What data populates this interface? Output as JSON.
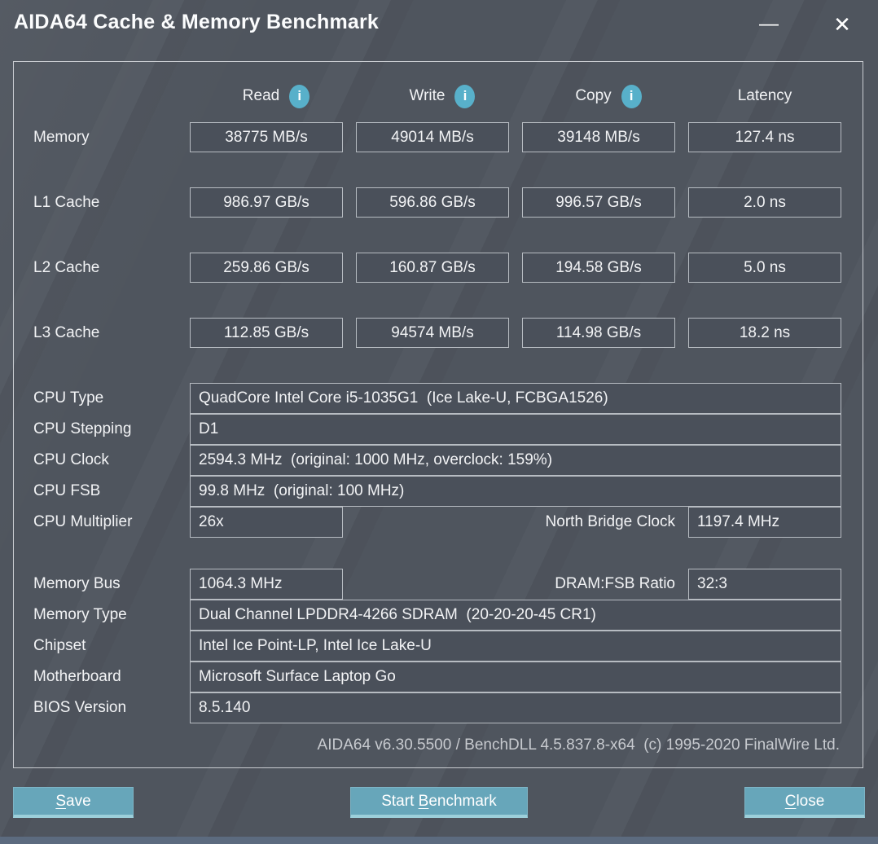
{
  "window": {
    "title": "AIDA64 Cache & Memory Benchmark",
    "minimize_glyph": "—",
    "close_glyph": "✕"
  },
  "colors": {
    "background": "#4f555e",
    "field_fill": "#4a505a",
    "field_border": "#b7bcc2",
    "info_icon_teal": "#58b0ca",
    "button_teal": "#67a6ba",
    "button_bottom_highlight": "#9ccfda",
    "bottom_strip": "#5c6b7f"
  },
  "info_glyph": "i",
  "benchmark": {
    "columns": [
      {
        "label": "Read",
        "has_info": true
      },
      {
        "label": "Write",
        "has_info": true
      },
      {
        "label": "Copy",
        "has_info": true
      },
      {
        "label": "Latency",
        "has_info": false
      }
    ],
    "rows": [
      {
        "label": "Memory",
        "values": [
          "38775 MB/s",
          "49014 MB/s",
          "39148 MB/s",
          "127.4 ns"
        ]
      },
      {
        "label": "L1 Cache",
        "values": [
          "986.97 GB/s",
          "596.86 GB/s",
          "996.57 GB/s",
          "2.0 ns"
        ]
      },
      {
        "label": "L2 Cache",
        "values": [
          "259.86 GB/s",
          "160.87 GB/s",
          "194.58 GB/s",
          "5.0 ns"
        ]
      },
      {
        "label": "L3 Cache",
        "values": [
          "112.85 GB/s",
          "94574 MB/s",
          "114.98 GB/s",
          "18.2 ns"
        ]
      }
    ]
  },
  "cpu_info": {
    "rows": [
      {
        "label": "CPU Type",
        "value": "QuadCore Intel Core i5-1035G1  (Ice Lake-U, FCBGA1526)"
      },
      {
        "label": "CPU Stepping",
        "value": "D1"
      },
      {
        "label": "CPU Clock",
        "value": "2594.3 MHz  (original: 1000 MHz, overclock: 159%)"
      },
      {
        "label": "CPU FSB",
        "value": "99.8 MHz  (original: 100 MHz)"
      },
      {
        "label": "CPU Multiplier",
        "value": "26x",
        "extra_label": "North Bridge Clock",
        "extra_value": "1197.4 MHz"
      }
    ]
  },
  "memory_info": {
    "rows": [
      {
        "label": "Memory Bus",
        "value": "1064.3 MHz",
        "extra_label": "DRAM:FSB Ratio",
        "extra_value": "32:3"
      },
      {
        "label": "Memory Type",
        "value": "Dual Channel LPDDR4-4266 SDRAM  (20-20-20-45 CR1)"
      },
      {
        "label": "Chipset",
        "value": "Intel Ice Point-LP, Intel Ice Lake-U"
      },
      {
        "label": "Motherboard",
        "value": "Microsoft Surface Laptop Go"
      },
      {
        "label": "BIOS Version",
        "value": "8.5.140"
      }
    ]
  },
  "footer": "AIDA64 v6.30.5500 / BenchDLL 4.5.837.8-x64  (c) 1995-2020 FinalWire Ltd.",
  "buttons": {
    "save": {
      "pre": "",
      "accel": "S",
      "post": "ave"
    },
    "start": {
      "pre": "Start ",
      "accel": "B",
      "post": "enchmark"
    },
    "close": {
      "pre": "",
      "accel": "C",
      "post": "lose"
    }
  }
}
